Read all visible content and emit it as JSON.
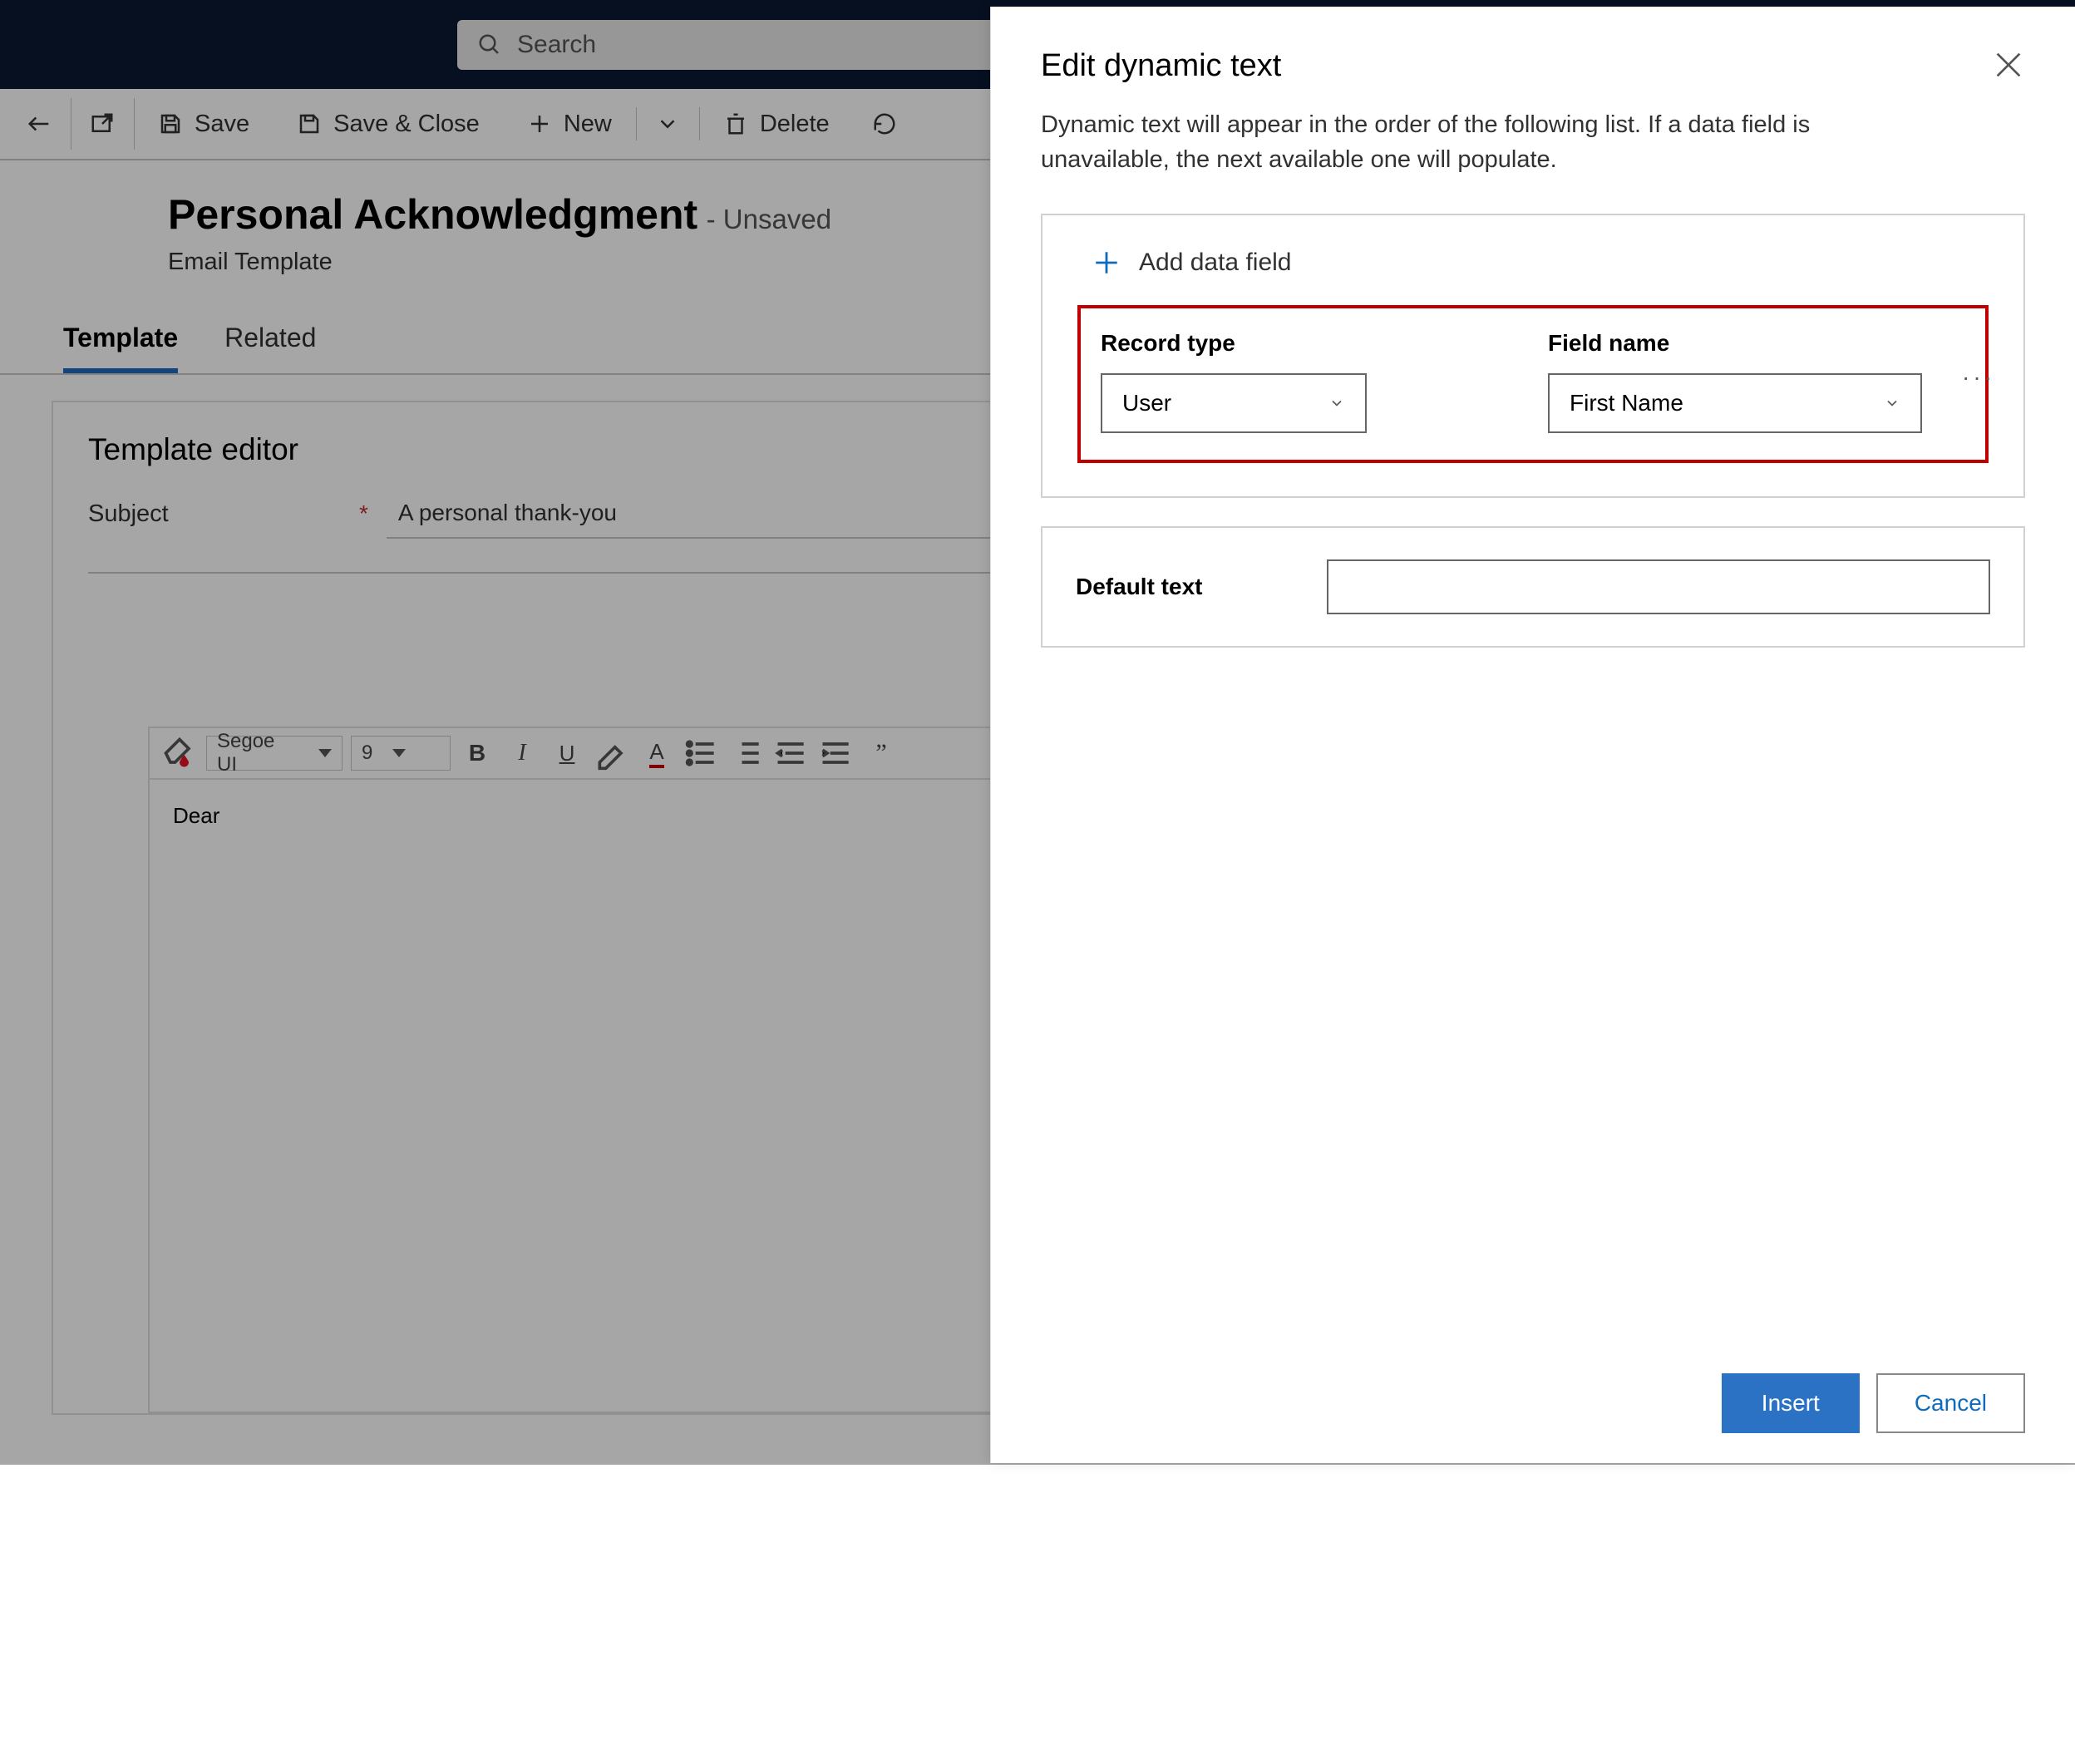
{
  "topbar": {
    "search_placeholder": "Search"
  },
  "commandbar": {
    "save": "Save",
    "save_close": "Save & Close",
    "new": "New",
    "delete": "Delete"
  },
  "header": {
    "title": "Personal Acknowledgment",
    "status": "- Unsaved",
    "subtitle": "Email Template"
  },
  "tabs": {
    "template": "Template",
    "related": "Related"
  },
  "editor": {
    "heading": "Template editor",
    "subject_label": "Subject",
    "subject_value": "A personal thank-you",
    "rte": {
      "font": "Segoe UI",
      "size": "9",
      "body": "Dear"
    }
  },
  "panel": {
    "title": "Edit dynamic text",
    "description": "Dynamic text will appear in the order of the following list. If a data field is unavailable, the next available one will populate.",
    "add_field": "Add data field",
    "record_type_label": "Record type",
    "record_type_value": "User",
    "field_name_label": "Field name",
    "field_name_value": "First Name",
    "default_text_label": "Default text",
    "default_text_value": "",
    "insert": "Insert",
    "cancel": "Cancel"
  }
}
